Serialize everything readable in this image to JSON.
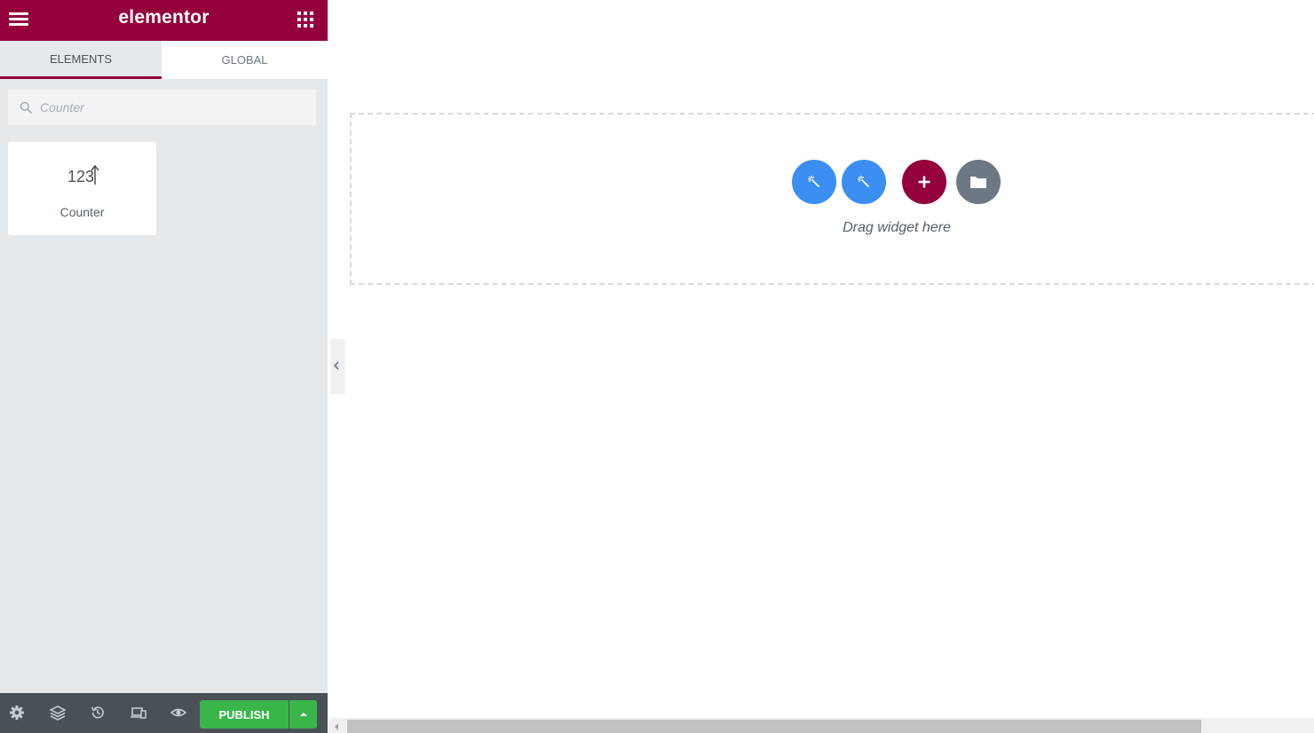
{
  "app": {
    "logo": "elementor",
    "brand_color": "#93003c"
  },
  "header": {
    "menu_icon": "hamburger-icon",
    "apps_icon": "grid-icon"
  },
  "tabs": [
    {
      "label": "ELEMENTS",
      "active": true
    },
    {
      "label": "GLOBAL",
      "active": false
    }
  ],
  "search": {
    "value": "Counter",
    "icon": "search-icon"
  },
  "widgets": [
    {
      "label": "Counter",
      "icon": "counter-icon",
      "icon_text": "123"
    }
  ],
  "footer": {
    "icons": [
      "settings-icon",
      "navigator-icon",
      "history-icon",
      "responsive-icon",
      "preview-icon"
    ],
    "publish_label": "PUBLISH",
    "publish_color": "#39b54a"
  },
  "canvas": {
    "drop_text": "Drag widget here",
    "buttons": [
      "magic-wand-icon",
      "magic-wand-icon",
      "plus-icon",
      "folder-icon"
    ],
    "magic_color": "#3b8ff3"
  }
}
